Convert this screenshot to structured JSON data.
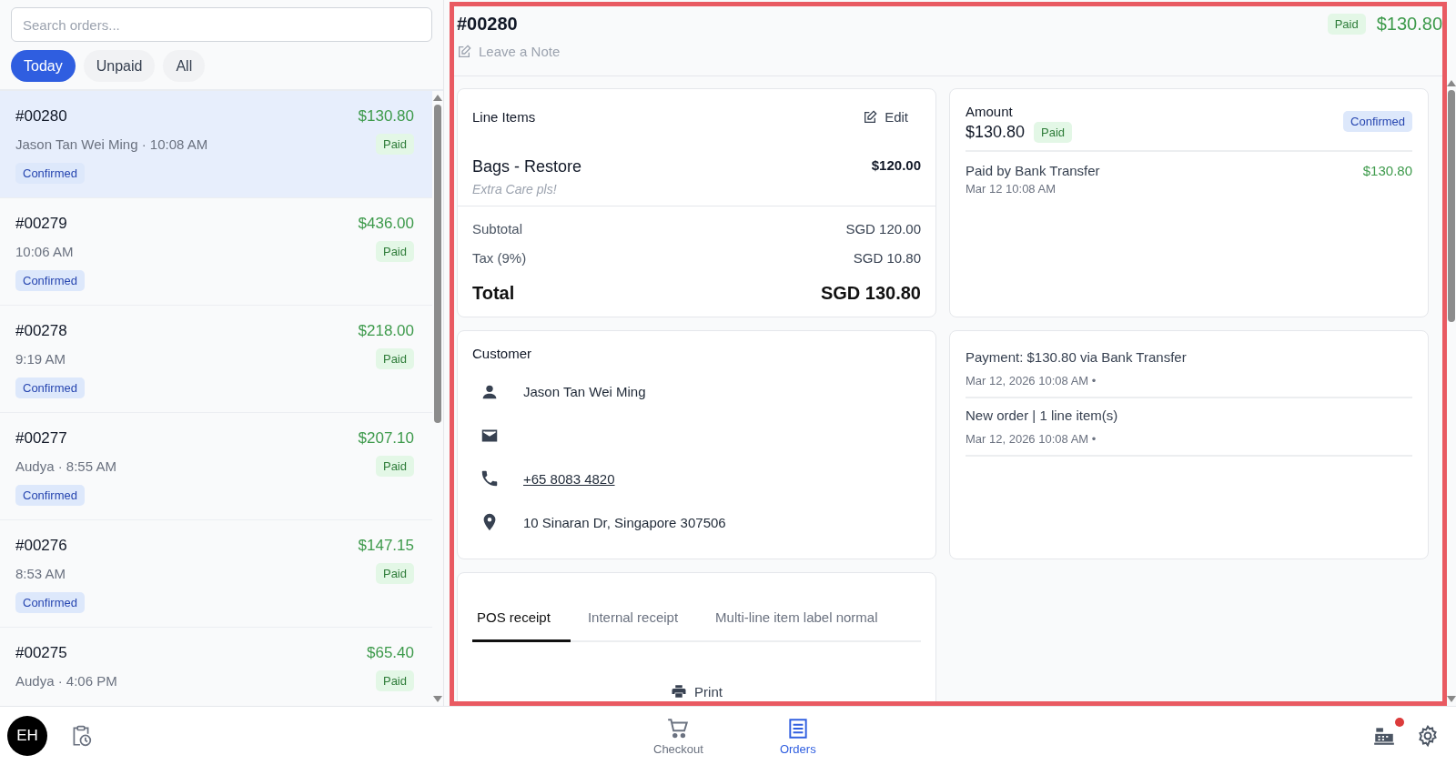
{
  "search": {
    "placeholder": "Search orders..."
  },
  "filters": [
    {
      "label": "Today",
      "selected": true
    },
    {
      "label": "Unpaid",
      "selected": false
    },
    {
      "label": "All",
      "selected": false
    }
  ],
  "orders": [
    {
      "number": "#00280",
      "amount": "$130.80",
      "meta": "Jason Tan Wei Ming · 10:08 AM",
      "payment": "Paid",
      "status": "Confirmed",
      "selected": true
    },
    {
      "number": "#00279",
      "amount": "$436.00",
      "meta": "10:06 AM",
      "payment": "Paid",
      "status": "Confirmed",
      "selected": false
    },
    {
      "number": "#00278",
      "amount": "$218.00",
      "meta": "9:19 AM",
      "payment": "Paid",
      "status": "Confirmed",
      "selected": false
    },
    {
      "number": "#00277",
      "amount": "$207.10",
      "meta": "Audya · 8:55 AM",
      "payment": "Paid",
      "status": "Confirmed",
      "selected": false
    },
    {
      "number": "#00276",
      "amount": "$147.15",
      "meta": "8:53 AM",
      "payment": "Paid",
      "status": "Confirmed",
      "selected": false
    },
    {
      "number": "#00275",
      "amount": "$65.40",
      "meta": "Audya · 4:06 PM",
      "payment": "Paid",
      "selected": false
    }
  ],
  "detail": {
    "highlighted": true,
    "number": "#00280",
    "payment": "Paid",
    "amount": "$130.80",
    "note_prompt": "Leave a Note",
    "line_items": {
      "title": "Line Items",
      "edit": "Edit",
      "items": [
        {
          "name": "Bags - Restore",
          "note": "Extra Care pls!",
          "price": "$120.00"
        }
      ],
      "totals": [
        {
          "kind": "normal",
          "label": "Subtotal",
          "value": "SGD 120.00"
        },
        {
          "kind": "normal",
          "label": "Tax (9%)",
          "value": "SGD 10.80"
        },
        {
          "kind": "grand",
          "label": "Total",
          "value": "SGD 130.80"
        }
      ]
    },
    "amount_card": {
      "title": "Amount",
      "amount": "$130.80",
      "payment": "Paid",
      "status": "Confirmed",
      "payments": [
        {
          "method": "Paid by Bank Transfer",
          "time": "Mar 12 10:08 AM",
          "amount": "$130.80"
        }
      ]
    },
    "customer": {
      "title": "Customer",
      "fields": [
        {
          "kind": "person",
          "value": "Jason Tan Wei Ming"
        },
        {
          "kind": "email"
        },
        {
          "kind": "phone",
          "value": "+65 8083 4820"
        },
        {
          "kind": "address",
          "value": "10 Sinaran Dr, Singapore 307506"
        }
      ]
    },
    "activity": [
      {
        "text": "Payment: $130.80 via Bank Transfer",
        "time": "Mar 12, 2026 10:08 AM •"
      },
      {
        "text": "New order | 1 line item(s)",
        "time": "Mar 12, 2026 10:08 AM •"
      }
    ],
    "receipt": {
      "tabs": [
        {
          "label": "POS receipt",
          "selected": true
        },
        {
          "label": "Internal receipt",
          "selected": false
        },
        {
          "label": "Multi-line item label normal",
          "selected": false
        }
      ],
      "print": "Print"
    }
  },
  "bottom_bar": {
    "avatar": "EH",
    "nav": [
      {
        "kind": "cart",
        "label": "Checkout",
        "selected": false
      },
      {
        "kind": "orders",
        "label": "Orders",
        "selected": true
      }
    ],
    "register_alert": true
  }
}
